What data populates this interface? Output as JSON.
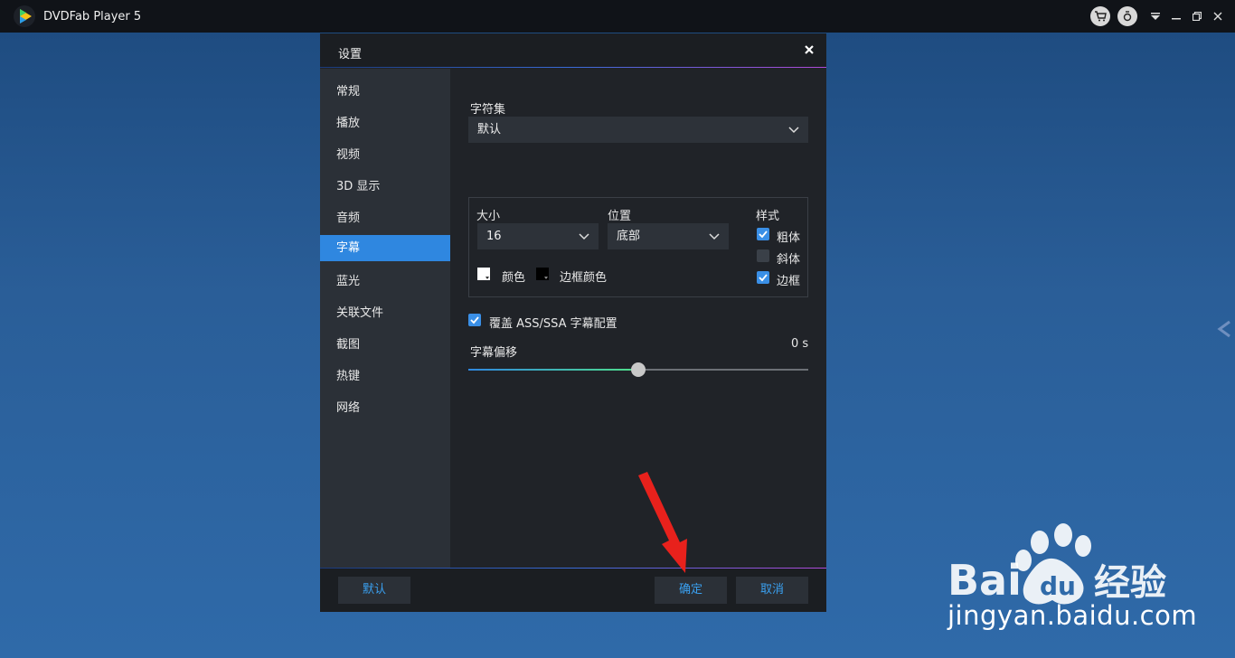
{
  "app": {
    "title": "DVDFab Player 5"
  },
  "titlebar": {
    "icons": [
      "cart-icon",
      "upgrade-icon",
      "menu-dropdown-icon",
      "minimize-icon",
      "restore-icon",
      "close-icon"
    ]
  },
  "dialog": {
    "title": "设置",
    "sidebar": [
      {
        "label": "常规"
      },
      {
        "label": "播放"
      },
      {
        "label": "视频"
      },
      {
        "label": "3D 显示"
      },
      {
        "label": "音频"
      },
      {
        "label": "字幕",
        "active": true
      },
      {
        "label": "蓝光"
      },
      {
        "label": "关联文件"
      },
      {
        "label": "截图"
      },
      {
        "label": "热键"
      },
      {
        "label": "网络"
      }
    ],
    "subtitle": {
      "charset_label": "字符集",
      "charset_value": "默认",
      "size_label": "大小",
      "size_value": "16",
      "position_label": "位置",
      "position_value": "底部",
      "style_label": "样式",
      "styles": [
        {
          "label": "粗体",
          "checked": true
        },
        {
          "label": "斜体",
          "checked": false
        },
        {
          "label": "边框",
          "checked": true
        }
      ],
      "color_label": "颜色",
      "color_value": "#ffffff",
      "border_color_label": "边框颜色",
      "border_color_value": "#000000",
      "override_label": "覆盖 ASS/SSA 字幕配置",
      "override_checked": true,
      "offset_label": "字幕偏移",
      "offset_value": "0 s",
      "offset_fraction": 0.5
    },
    "footer": {
      "default_label": "默认",
      "ok_label": "确定",
      "cancel_label": "取消"
    }
  },
  "colors": {
    "accent": "#2f87e0",
    "footer_button_text": "#3aa0f0",
    "annotation_arrow": "#e8211c"
  },
  "watermark": {
    "text": "jingyan.baidu.com",
    "logo_text": "Baidu经验"
  }
}
